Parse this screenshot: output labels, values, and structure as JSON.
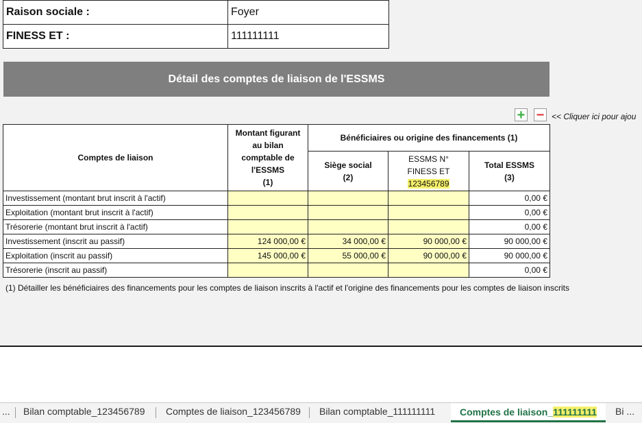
{
  "header": {
    "raison_sociale_label": "Raison sociale :",
    "raison_sociale_value": "Foyer",
    "finess_label": "FINESS ET :",
    "finess_value": "111111111"
  },
  "banner_title": "Détail des comptes de liaison de l'ESSMS",
  "controls": {
    "add_symbol": "+",
    "remove_symbol": "−",
    "hint": "<< Cliquer ici pour ajou"
  },
  "table": {
    "col_comptes": "Comptes de liaison",
    "col_montant_lines": [
      "Montant figurant",
      "au bilan",
      "comptable de",
      "l'ESSMS",
      "(1)"
    ],
    "group_header": "Bénéficiaires ou origine des financements (1)",
    "col_siege_lines": [
      "Siège social",
      "(2)"
    ],
    "col_essms_lines": [
      "ESSMS N°",
      "FINESS ET",
      "123456789"
    ],
    "col_total_lines": [
      "Total ESSMS",
      "(3)"
    ],
    "rows": [
      {
        "label": "Investissement (montant brut inscrit à l'actif)",
        "montant": "",
        "siege": "",
        "essms": "",
        "total": "0,00 €"
      },
      {
        "label": "Exploitation (montant brut inscrit à l'actif)",
        "montant": "",
        "siege": "",
        "essms": "",
        "total": "0,00 €"
      },
      {
        "label": "Trésorerie (montant brut inscrit à l'actif)",
        "montant": "",
        "siege": "",
        "essms": "",
        "total": "0,00 €"
      },
      {
        "label": "Investissement (inscrit au passif)",
        "montant": "124 000,00 €",
        "siege": "34 000,00 €",
        "essms": "90 000,00 €",
        "total": "90 000,00 €"
      },
      {
        "label": "Exploitation (inscrit au passif)",
        "montant": "145 000,00 €",
        "siege": "55 000,00 €",
        "essms": "90 000,00 €",
        "total": "90 000,00 €"
      },
      {
        "label": "Trésorerie (inscrit au passif)",
        "montant": "",
        "siege": "",
        "essms": "",
        "total": "0,00 €"
      }
    ]
  },
  "footnote": "(1) Détailler les bénéficiaires des financements pour les comptes de liaison inscrits à l'actif et l'origine des financements pour les comptes de liaison inscrits",
  "sheet_tabs": {
    "ellipsis_left": "...",
    "tab1": "Bilan comptable_123456789",
    "tab2": "Comptes de liaison_123456789",
    "tab3": "Bilan comptable_111111111",
    "active_prefix": "Comptes de liaison_",
    "active_suffix": "111111111",
    "tab5": "Bi ..."
  },
  "colors": {
    "banner": "#7f7f7f",
    "input_cell": "#ffffc4",
    "highlight": "#f5f06a",
    "active_tab": "#217346"
  }
}
